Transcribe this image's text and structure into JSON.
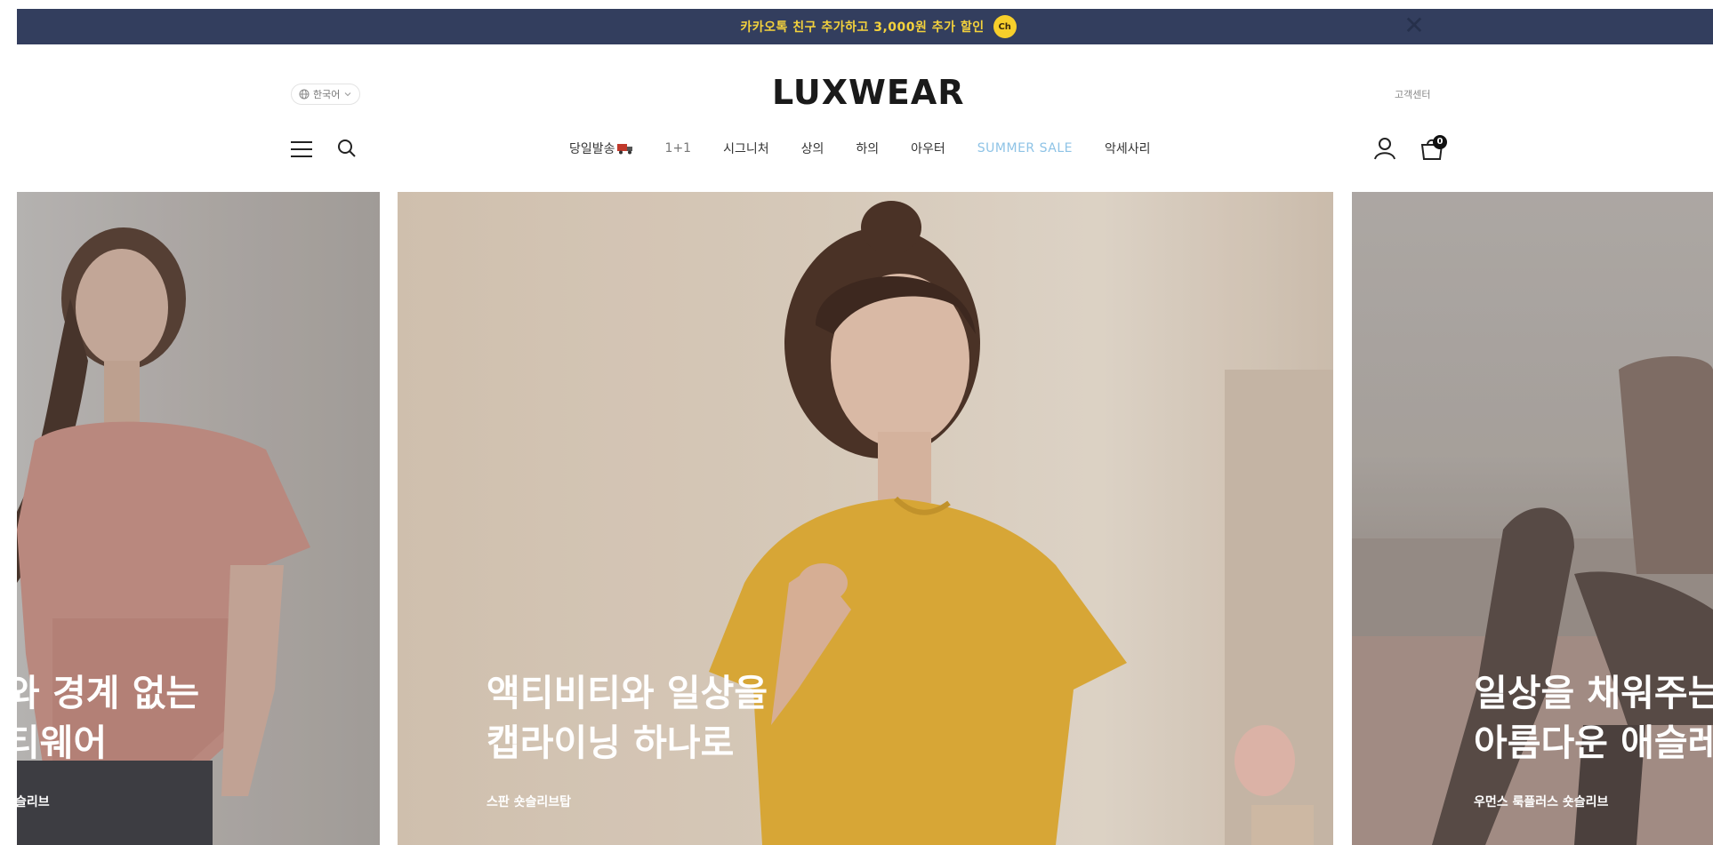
{
  "promo": {
    "text": "카카오톡 친구 추가하고 3,000원 추가 할인",
    "badge": "Ch",
    "close_glyph": "✕"
  },
  "header": {
    "language": "한국어",
    "logo": "LUXWEAR",
    "customer_center": "고객센터",
    "cart_count": "0"
  },
  "nav": {
    "items": [
      {
        "label": "당일발송"
      },
      {
        "label": "1+1"
      },
      {
        "label": "시그니처"
      },
      {
        "label": "상의"
      },
      {
        "label": "하의"
      },
      {
        "label": "아우터"
      },
      {
        "label": "SUMMER SALE"
      },
      {
        "label": "악세사리"
      }
    ]
  },
  "slides": [
    {
      "title_line1": "와 경계 없는",
      "title_line2": "티웨어",
      "subtitle": "슬리브"
    },
    {
      "title_line1": "액티비티와 일상을",
      "title_line2": "캡라이닝 하나로",
      "subtitle": "스판 숏슬리브탑"
    },
    {
      "title_line1": "일상을 채워주는",
      "title_line2": "아름다운 애슬레",
      "subtitle": "우먼스 룩플러스 숏슬리브"
    }
  ],
  "icons": {
    "globe": "globe-icon",
    "menu": "hamburger-menu-icon",
    "search": "search-icon",
    "user": "user-icon",
    "cart": "shopping-bag-icon"
  },
  "colors": {
    "promo_bg": "#333e5e",
    "promo_text": "#f4d23c",
    "sale": "#8ec3e6"
  }
}
